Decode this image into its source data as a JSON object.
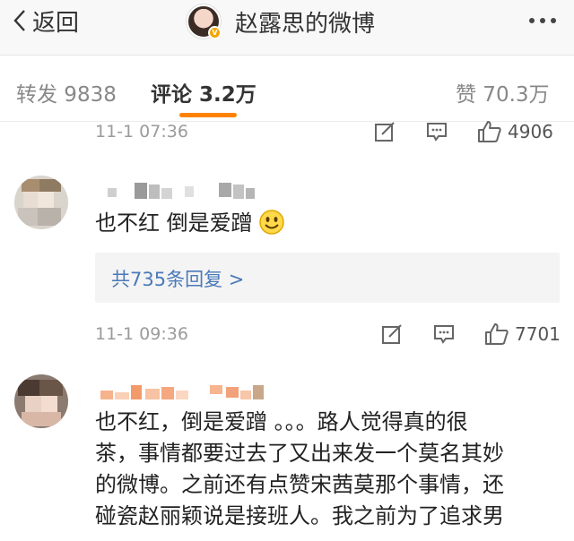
{
  "header": {
    "back_label": "返回",
    "title": "赵露思的微博",
    "more_icon": "more-dots-icon"
  },
  "tabs": [
    {
      "label": "转发 9838",
      "active": false
    },
    {
      "label": "评论 3.2万",
      "active": true
    },
    {
      "label": "赞 70.3万",
      "active": false
    }
  ],
  "colors": {
    "accent": "#ff8200",
    "link": "#4a7ab8"
  },
  "top_meta": {
    "time": "11-1 07:36",
    "likes": "4906"
  },
  "comments": [
    {
      "text": "也不红 倒是爱蹭",
      "emoji": "smile-emoji",
      "replies_label": "共735条回复 >",
      "time": "11-1 09:36",
      "likes": "7701"
    },
    {
      "lines": [
        "也不红，倒是爱蹭 。。。路人觉得真的很",
        "茶，事情都要过去了又出来发一个莫名其妙",
        "的微博。之前还有点赞宋茜莫那个事情，还",
        "碰瓷赵丽颖说是接班人。我之前为了追求男"
      ]
    }
  ]
}
